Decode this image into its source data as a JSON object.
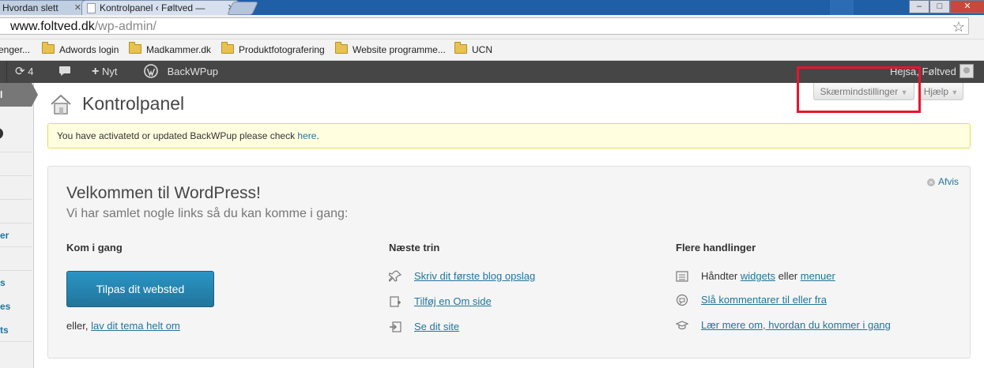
{
  "browser": {
    "tabs": [
      {
        "label": "Hvordan slett"
      },
      {
        "label": "Kontrolpanel ‹ Føltved — "
      }
    ],
    "address": {
      "host": "www.foltved.dk",
      "path": "/wp-admin/"
    },
    "bookmarks": [
      "enger...",
      "Adwords login",
      "Madkammer.dk",
      "Produktfotografering",
      "Website programme...",
      "UCN"
    ]
  },
  "adminbar": {
    "updates_count": "4",
    "new_label": "Nyt",
    "backwpup_label": "BackWPup",
    "greeting": "Hejsa, Føltved"
  },
  "leftmenu": {
    "current_fragment": "l",
    "items": [
      "er",
      "s",
      "es",
      "ts"
    ]
  },
  "page": {
    "title": "Kontrolpanel",
    "screen_options_label": "Skærmindstillinger",
    "help_label": "Hjælp",
    "notice_text": "You have activatetd or updated BackWPup please check ",
    "notice_link": "here",
    "notice_tail": "."
  },
  "welcome": {
    "title": "Velkommen til WordPress!",
    "subtitle": "Vi har samlet nogle links så du kan komme i gang:",
    "dismiss": "Afvis",
    "col1": {
      "heading": "Kom i gang",
      "button": "Tilpas dit websted",
      "or_prefix": "eller, ",
      "or_link": "lav dit tema helt om"
    },
    "col2": {
      "heading": "Næste trin",
      "links": [
        "Skriv dit første blog opslag",
        "Tilføj en Om side",
        "Se dit site"
      ]
    },
    "col3": {
      "heading": "Flere handlinger",
      "manage_prefix": "Håndter ",
      "widgets": "widgets",
      "manage_mid": " eller ",
      "menus": "menuer",
      "comments_link": "Slå kommentarer til eller fra",
      "learn_link": "Lær mere om, hvordan du kommer i gang"
    }
  },
  "colors": {
    "admin_bar": "#464646",
    "link": "#21759b",
    "button": "#21759b",
    "highlight": "#e8142d"
  }
}
